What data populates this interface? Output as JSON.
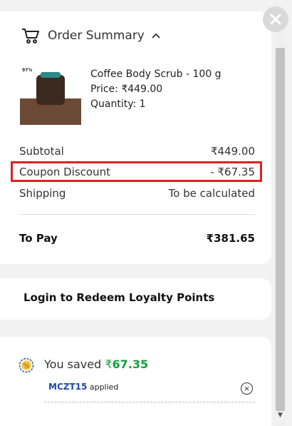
{
  "summary": {
    "title": "Order Summary",
    "product": {
      "name": "Coffee Body Scrub - 100 g",
      "price": "Price: ₹449.00",
      "quantity": "Quantity: 1",
      "image_badge": "97%"
    },
    "subtotal_label": "Subtotal",
    "subtotal_value": "₹449.00",
    "coupon_label": "Coupon Discount",
    "coupon_value": "- ₹67.35",
    "shipping_label": "Shipping",
    "shipping_value": "To be calculated",
    "to_pay_label": "To Pay",
    "to_pay_value": "₹381.65"
  },
  "loyalty": {
    "label": "Login to Redeem Loyalty Points"
  },
  "savings": {
    "prefix": "You saved ",
    "currency": "₹",
    "amount": "67.35",
    "code": "MCZT15",
    "code_suffix": " applied"
  },
  "colors": {
    "highlight_border": "#e02020",
    "saved_green": "#1a9c3e",
    "code_blue": "#1f4aa8"
  }
}
